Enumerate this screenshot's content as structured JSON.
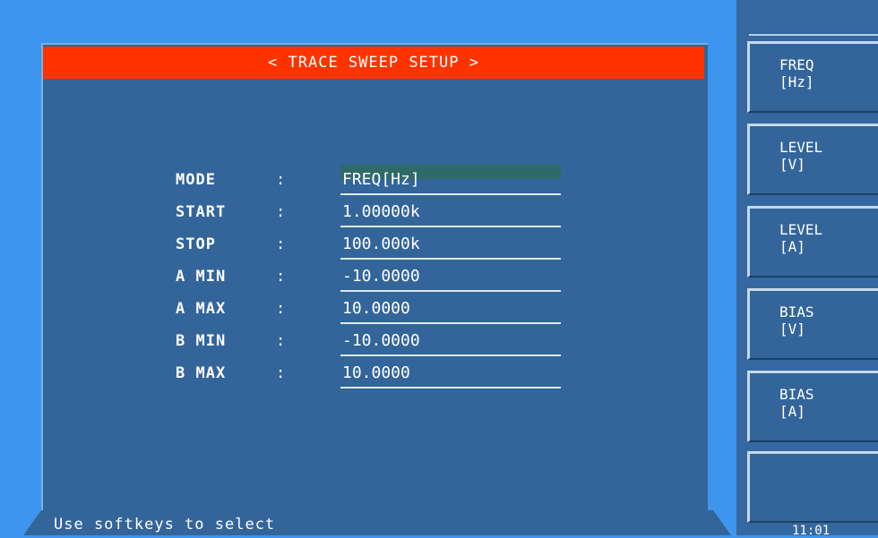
{
  "title": "< TRACE SWEEP SETUP >",
  "fields": [
    {
      "label": "MODE",
      "colon": ":",
      "value": "FREQ[Hz]"
    },
    {
      "label": "START",
      "colon": ":",
      "value": "1.00000k"
    },
    {
      "label": "STOP",
      "colon": ":",
      "value": "100.000k"
    },
    {
      "label": "A MIN",
      "colon": ":",
      "value": "-10.0000"
    },
    {
      "label": "A MAX",
      "colon": ":",
      "value": "10.0000"
    },
    {
      "label": "B MIN",
      "colon": ":",
      "value": "-10.0000"
    },
    {
      "label": "B MAX",
      "colon": ":",
      "value": "10.0000"
    }
  ],
  "status": "Use softkeys to select",
  "softkeys": [
    {
      "line1": "FREQ",
      "line2": "[Hz]"
    },
    {
      "line1": "LEVEL",
      "line2": "[V]"
    },
    {
      "line1": "LEVEL",
      "line2": "[A]"
    },
    {
      "line1": "BIAS",
      "line2": "[V]"
    },
    {
      "line1": "BIAS",
      "line2": "[A]"
    },
    {
      "line1": "",
      "line2": ""
    }
  ],
  "clock": "11:01",
  "colors": {
    "title_bar": "#ff3300",
    "panel": "#33659a",
    "background": "#3d95ee"
  }
}
